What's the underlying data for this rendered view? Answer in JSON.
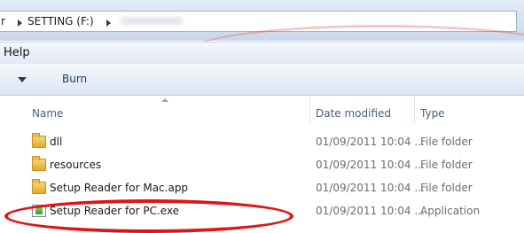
{
  "address": {
    "crumb_prefix": "r",
    "drive": "SETTING (F:)"
  },
  "menu": {
    "help_label": "Help"
  },
  "toolbar": {
    "burn_label": "Burn"
  },
  "columns": {
    "name": "Name",
    "date": "Date modified",
    "type": "Type"
  },
  "files": [
    {
      "name": "dll",
      "date": "01/09/2011 10:04 ...",
      "type": "File folder",
      "icon": "folder-icon"
    },
    {
      "name": "resources",
      "date": "01/09/2011 10:04 ...",
      "type": "File folder",
      "icon": "folder-icon"
    },
    {
      "name": "Setup Reader for Mac.app",
      "date": "01/09/2011 10:04 ...",
      "type": "File folder",
      "icon": "folder-icon"
    },
    {
      "name": "Setup Reader for PC.exe",
      "date": "01/09/2011 10:04 ...",
      "type": "Application",
      "icon": "application-icon"
    }
  ],
  "colors": {
    "highlight_circle": "#e01414",
    "column_header_text": "#4c607a",
    "toolbar_text": "#1e3957"
  }
}
